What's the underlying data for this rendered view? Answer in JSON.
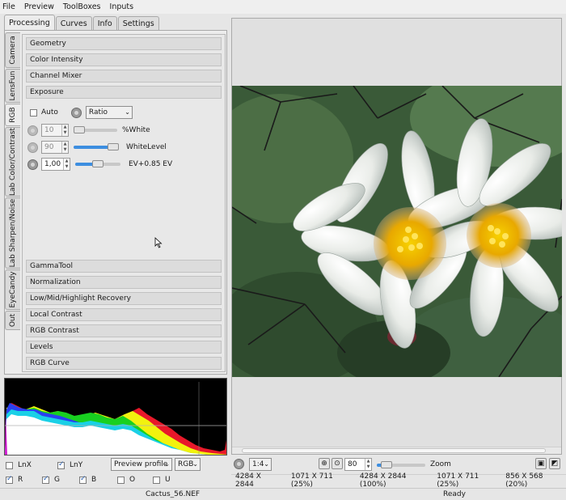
{
  "menubar": {
    "items": [
      "File",
      "Preview",
      "ToolBoxes",
      "Inputs"
    ]
  },
  "top_tabs": [
    "Processing",
    "Curves",
    "Info",
    "Settings"
  ],
  "side_tabs": [
    "Camera",
    "LensFun",
    "RGB",
    "Lab Color/Contrast",
    "Lab Sharpen/Noise",
    "EyeCandy",
    "Out"
  ],
  "sections_top": [
    "Geometry",
    "Color Intensity",
    "Channel  Mixer",
    "Exposure"
  ],
  "exposure": {
    "auto_label": "Auto",
    "mode_value": "Ratio",
    "white_value": "10",
    "white_label": "%White",
    "white_fill": 0.12,
    "level_value": "90",
    "level_label": "WhiteLevel",
    "level_fill": 0.9,
    "ev_value": "1,00",
    "ev_label": "EV+0.85 EV",
    "ev_fill": 0.5
  },
  "sections_bottom": [
    "GammaTool",
    "Normalization",
    "Low/Mid/Highlight Recovery",
    "Local Contrast",
    "RGB Contrast",
    "Levels",
    "RGB Curve"
  ],
  "histogram_options": {
    "lnx_label": "LnX",
    "lny_label": "LnY",
    "profile_value": "Preview profile",
    "space_value": "RGB",
    "r_label": "R",
    "g_label": "G",
    "b_label": "B",
    "o_label": "O",
    "u_label": "U"
  },
  "zoom": {
    "ratio": "1:4",
    "value": "80",
    "label": "Zoom",
    "fill": 0.2
  },
  "info_bar": [
    "4284 X 2844",
    "1071 X 711 (25%)",
    "4284 X 2844 (100%)",
    "1071 X 711 (25%)",
    "856 X 568 (20%)"
  ],
  "status": {
    "filename": "Cactus_56.NEF",
    "state": "Ready"
  },
  "colors": {
    "accent": "#3d8ee0",
    "histogram_bg": "#000000"
  },
  "icons": [
    "lock-icon",
    "zoom-in-icon",
    "zoom-fit-icon",
    "save-icon",
    "export-icon",
    "cursor-icon"
  ]
}
